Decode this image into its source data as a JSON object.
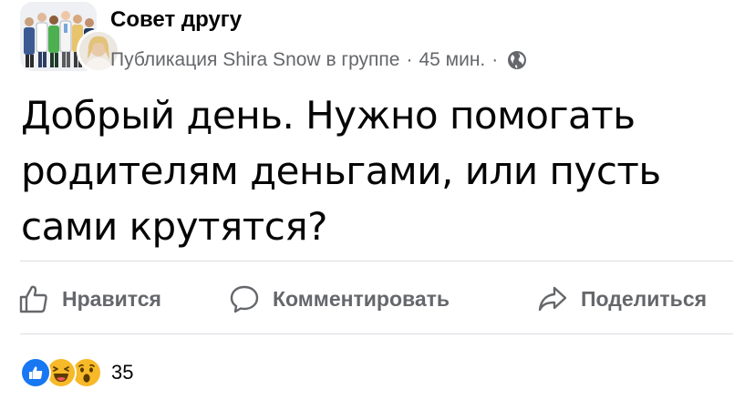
{
  "header": {
    "group_name": "Совет другу",
    "meta_prefix": "Публикация",
    "author": "Shira Snow",
    "meta_suffix": "в группе",
    "separator": "·",
    "time": "45 мин.",
    "privacy_icon": "globe-icon"
  },
  "post": {
    "text": "Добрый день. Нужно помогать родителям деньгами, или пусть сами крутятся?"
  },
  "actions": {
    "like_label": "Нравится",
    "like_icon": "thumbs-up-icon",
    "comment_label": "Комментировать",
    "comment_icon": "comment-bubble-icon",
    "share_label": "Поделиться",
    "share_icon": "share-arrow-icon"
  },
  "reactions": {
    "types": [
      "like",
      "haha",
      "wow"
    ],
    "count": "35"
  },
  "colors": {
    "text_primary": "#050505",
    "text_secondary": "#65676b",
    "like_blue": "#1877f2",
    "emoji_yellow": "#f7b928",
    "divider": "#dadde1"
  }
}
